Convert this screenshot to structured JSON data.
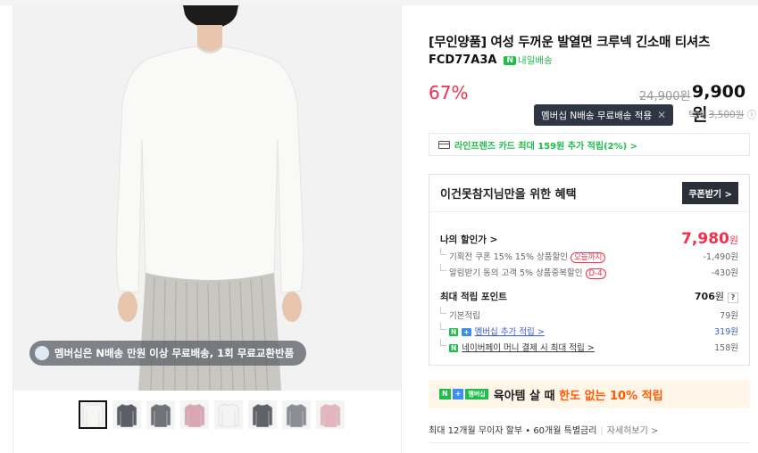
{
  "gallery": {
    "promo_text": "멤버십은 N배송 만원 이상 무료배송, 1회 무료교환반품"
  },
  "product": {
    "title": "[무인양품] 여성 두꺼운 발열면 크루넥 긴소매 티셔츠",
    "code": "FCD77A3A",
    "ship_badge_icon": "N",
    "ship_badge_text": "내일배송",
    "discount": "67%",
    "original_price": "24,900원",
    "sale_price": "9,900원"
  },
  "tooltip": {
    "text": "멤버십 N배송 무료배송 적용",
    "close": "✕"
  },
  "shipping": {
    "label": "택배",
    "fee": "3,500원",
    "info_icon": "ⓘ"
  },
  "card_promo": {
    "text": "라인프렌즈 카드 최대 159원 추가 적립(2%) >"
  },
  "benefit": {
    "title": "이건못참지님만을 위한 혜택",
    "coupon_button": "쿠폰받기 >",
    "my_discount_label": "나의 할인가 >",
    "my_price_value": "7,980",
    "my_price_unit": "원",
    "discounts": [
      {
        "label": "기획전 쿠폰 15% 15% 상품할인",
        "tag": "오늘까지",
        "amount": "-1,490원"
      },
      {
        "label": "알림받기 동의 고객 5% 상품중복할인",
        "tag": "D-4",
        "amount": "-430원"
      }
    ],
    "max_points_label": "최대 적립 포인트",
    "max_points_value": "706",
    "max_points_unit": "원",
    "help": "?",
    "points": [
      {
        "label": "기본적립",
        "amount": "79원"
      },
      {
        "badge1": "N",
        "badge2": "+",
        "label": "멤버십 추가 적립 >",
        "amount": "319원"
      },
      {
        "badge1": "N",
        "label": "네이버페이 머니 결제 시 최대 적립 >",
        "amount": "158원"
      }
    ]
  },
  "banner": {
    "badge_n": "N",
    "badge_plus": "+",
    "badge_membership": "멤버십",
    "text_main": "육아템 살 때",
    "text_highlight": "한도 없는 10% 적립"
  },
  "installment": {
    "text": "최대 12개월 무이자 할부 • 60개월 특별금리",
    "more": "자세히보기 >"
  },
  "colors": {
    "accent_red": "#f3304a",
    "naver_green": "#1fbe4a",
    "link_blue": "#3b5bdb"
  },
  "thumbnails": [
    {
      "color": "#f6f6f4"
    },
    {
      "color": "#5b5e66"
    },
    {
      "color": "#6f7378"
    },
    {
      "color": "#d8a7b3"
    },
    {
      "color": "#f4f4f2"
    },
    {
      "color": "#5f6268"
    },
    {
      "color": "#8a8e94"
    },
    {
      "color": "#e3b6bf"
    }
  ]
}
